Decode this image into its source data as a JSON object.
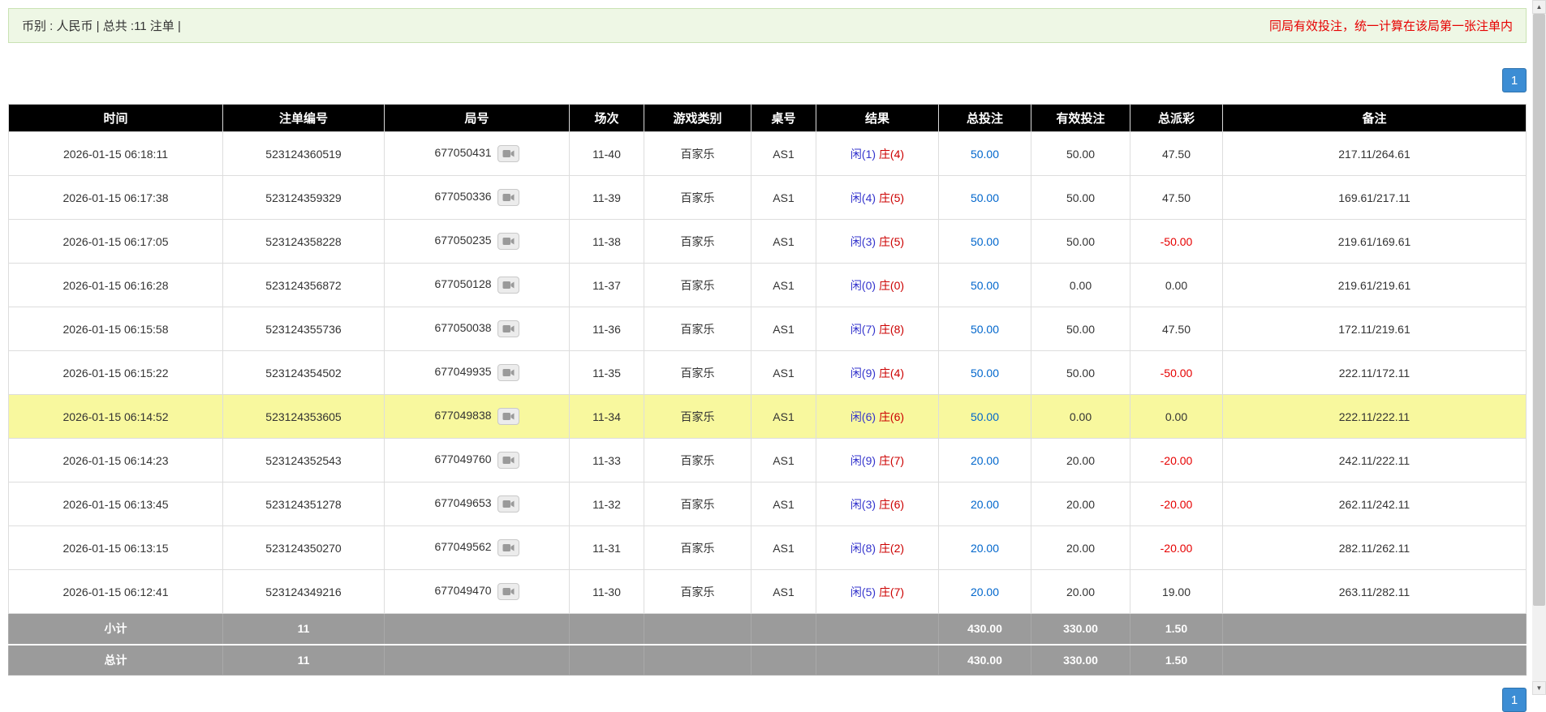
{
  "topbar": {
    "left": "币别 : 人民币 | 总共 :11 注单 |",
    "right": "同局有效投注，统一计算在该局第一张注单内"
  },
  "pagination": {
    "page": "1"
  },
  "table": {
    "headers": [
      "时间",
      "注单编号",
      "局号",
      "场次",
      "游戏类别",
      "桌号",
      "结果",
      "总投注",
      "有效投注",
      "总派彩",
      "备注"
    ],
    "rows": [
      {
        "time": "2026-01-15 06:18:11",
        "bet_id": "523124360519",
        "round": "677050431",
        "session": "11-40",
        "game": "百家乐",
        "table_no": "AS1",
        "player": "闲(1)",
        "banker": "庄(4)",
        "total_bet": "50.00",
        "valid_bet": "50.00",
        "payout": "47.50",
        "remark": "217.11/264.61",
        "highlighted": false
      },
      {
        "time": "2026-01-15 06:17:38",
        "bet_id": "523124359329",
        "round": "677050336",
        "session": "11-39",
        "game": "百家乐",
        "table_no": "AS1",
        "player": "闲(4)",
        "banker": "庄(5)",
        "total_bet": "50.00",
        "valid_bet": "50.00",
        "payout": "47.50",
        "remark": "169.61/217.11",
        "highlighted": false
      },
      {
        "time": "2026-01-15 06:17:05",
        "bet_id": "523124358228",
        "round": "677050235",
        "session": "11-38",
        "game": "百家乐",
        "table_no": "AS1",
        "player": "闲(3)",
        "banker": "庄(5)",
        "total_bet": "50.00",
        "valid_bet": "50.00",
        "payout": "-50.00",
        "remark": "219.61/169.61",
        "highlighted": false
      },
      {
        "time": "2026-01-15 06:16:28",
        "bet_id": "523124356872",
        "round": "677050128",
        "session": "11-37",
        "game": "百家乐",
        "table_no": "AS1",
        "player": "闲(0)",
        "banker": "庄(0)",
        "total_bet": "50.00",
        "valid_bet": "0.00",
        "payout": "0.00",
        "remark": "219.61/219.61",
        "highlighted": false
      },
      {
        "time": "2026-01-15 06:15:58",
        "bet_id": "523124355736",
        "round": "677050038",
        "session": "11-36",
        "game": "百家乐",
        "table_no": "AS1",
        "player": "闲(7)",
        "banker": "庄(8)",
        "total_bet": "50.00",
        "valid_bet": "50.00",
        "payout": "47.50",
        "remark": "172.11/219.61",
        "highlighted": false
      },
      {
        "time": "2026-01-15 06:15:22",
        "bet_id": "523124354502",
        "round": "677049935",
        "session": "11-35",
        "game": "百家乐",
        "table_no": "AS1",
        "player": "闲(9)",
        "banker": "庄(4)",
        "total_bet": "50.00",
        "valid_bet": "50.00",
        "payout": "-50.00",
        "remark": "222.11/172.11",
        "highlighted": false
      },
      {
        "time": "2026-01-15 06:14:52",
        "bet_id": "523124353605",
        "round": "677049838",
        "session": "11-34",
        "game": "百家乐",
        "table_no": "AS1",
        "player": "闲(6)",
        "banker": "庄(6)",
        "total_bet": "50.00",
        "valid_bet": "0.00",
        "payout": "0.00",
        "remark": "222.11/222.11",
        "highlighted": true
      },
      {
        "time": "2026-01-15 06:14:23",
        "bet_id": "523124352543",
        "round": "677049760",
        "session": "11-33",
        "game": "百家乐",
        "table_no": "AS1",
        "player": "闲(9)",
        "banker": "庄(7)",
        "total_bet": "20.00",
        "valid_bet": "20.00",
        "payout": "-20.00",
        "remark": "242.11/222.11",
        "highlighted": false
      },
      {
        "time": "2026-01-15 06:13:45",
        "bet_id": "523124351278",
        "round": "677049653",
        "session": "11-32",
        "game": "百家乐",
        "table_no": "AS1",
        "player": "闲(3)",
        "banker": "庄(6)",
        "total_bet": "20.00",
        "valid_bet": "20.00",
        "payout": "-20.00",
        "remark": "262.11/242.11",
        "highlighted": false
      },
      {
        "time": "2026-01-15 06:13:15",
        "bet_id": "523124350270",
        "round": "677049562",
        "session": "11-31",
        "game": "百家乐",
        "table_no": "AS1",
        "player": "闲(8)",
        "banker": "庄(2)",
        "total_bet": "20.00",
        "valid_bet": "20.00",
        "payout": "-20.00",
        "remark": "282.11/262.11",
        "highlighted": false
      },
      {
        "time": "2026-01-15 06:12:41",
        "bet_id": "523124349216",
        "round": "677049470",
        "session": "11-30",
        "game": "百家乐",
        "table_no": "AS1",
        "player": "闲(5)",
        "banker": "庄(7)",
        "total_bet": "20.00",
        "valid_bet": "20.00",
        "payout": "19.00",
        "remark": "263.11/282.11",
        "highlighted": false
      }
    ],
    "subtotal": {
      "label": "小计",
      "count": "11",
      "total_bet": "430.00",
      "valid_bet": "330.00",
      "payout": "1.50"
    },
    "total": {
      "label": "总计",
      "count": "11",
      "total_bet": "430.00",
      "valid_bet": "330.00",
      "payout": "1.50"
    }
  },
  "icons": {
    "round_replay": "video-camera",
    "scroll_up": "▲",
    "scroll_down": "▼"
  },
  "colors": {
    "bar-green": "#eef7e5",
    "bar-green-border": "#c9e2b3",
    "notice-red": "#e60000",
    "pagination-blue": "#3c8dd4",
    "pagination-blue-border": "#2f73ad",
    "link-blue": "#0066cc",
    "player-blue": "#3333cc",
    "banker-red": "#cc0000",
    "negative-red": "#e60000",
    "highlight-yellow": "#f8f89e"
  }
}
